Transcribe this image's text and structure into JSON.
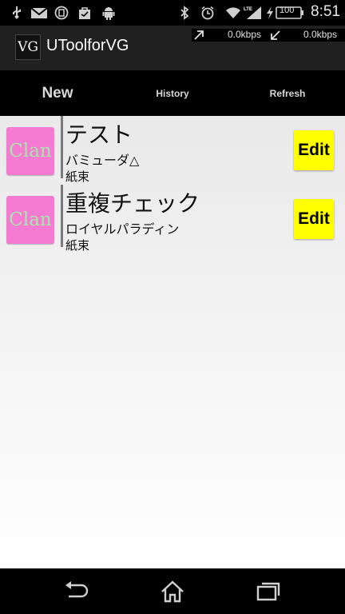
{
  "status_bar": {
    "time": "8:51",
    "battery": "100",
    "network": "LTE",
    "icons": [
      "usb-icon",
      "gmail-icon",
      "notification-icon",
      "bag-icon",
      "android-icon",
      "bluetooth-icon",
      "alarm-icon",
      "wifi-icon",
      "signal-icon",
      "charging-icon",
      "battery-icon"
    ]
  },
  "action_bar": {
    "logo": "VG",
    "title": "UToolforVG",
    "upload_speed": "0.0kbps",
    "download_speed": "0.0kbps"
  },
  "tabs": [
    {
      "label": "New"
    },
    {
      "label": "History"
    },
    {
      "label": "Refresh"
    }
  ],
  "list": [
    {
      "badge": "Clan",
      "title": "テスト",
      "subtitle": "バミューダ△",
      "note": "紙束",
      "action": "Edit"
    },
    {
      "badge": "Clan",
      "title": "重複チェック",
      "subtitle": "ロイヤルパラディン",
      "note": "紙束",
      "action": "Edit"
    }
  ],
  "colors": {
    "clan_badge": "#f57ad2",
    "clan_text": "#a9e6a9",
    "edit_button": "#ffff00",
    "action_bar": "#202020"
  }
}
